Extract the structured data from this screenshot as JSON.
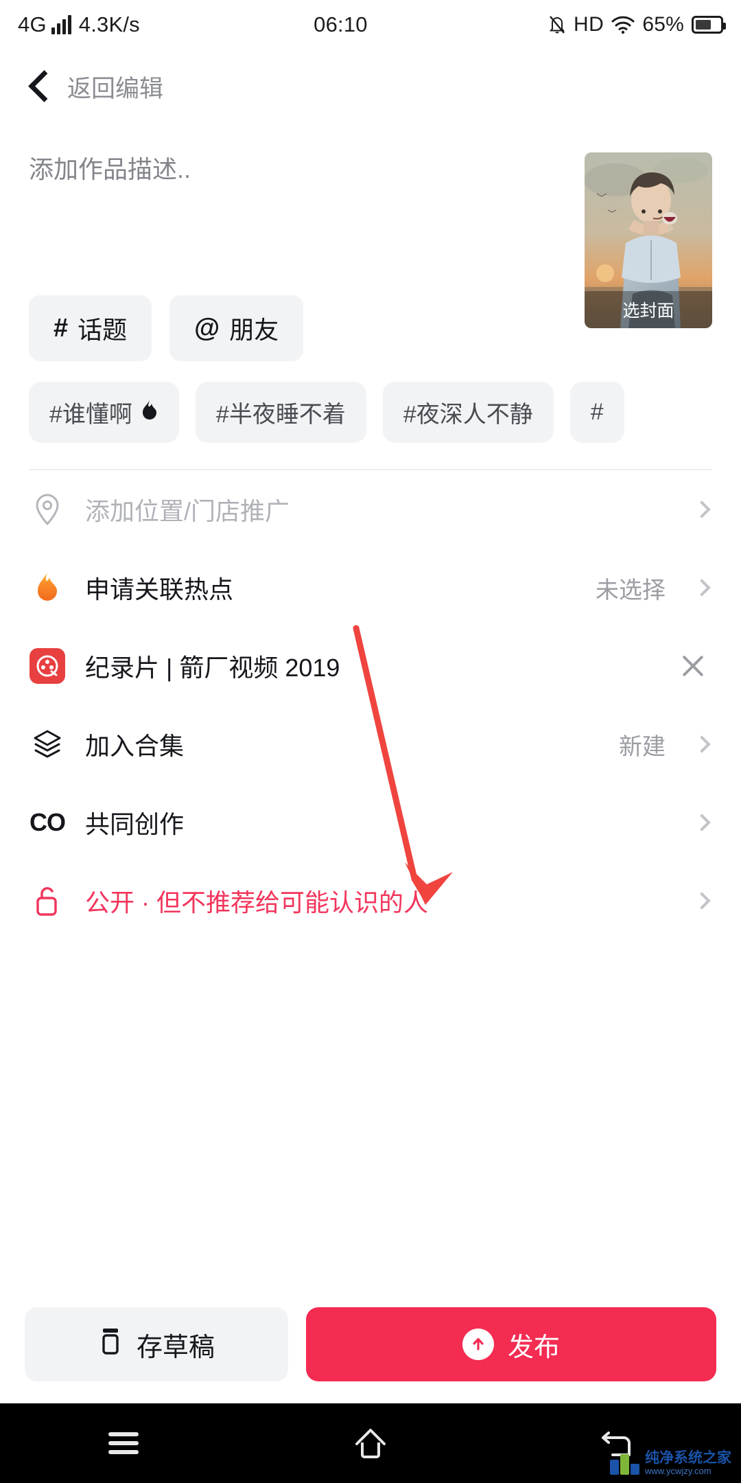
{
  "status_bar": {
    "network_type": "4G",
    "speed": "4.3K/s",
    "time": "06:10",
    "hd": "HD",
    "battery_percent": "65%",
    "signal_icon": "signal-bars-icon",
    "mute_icon": "bell-muted-icon",
    "wifi_icon": "wifi-icon",
    "battery_icon": "battery-icon"
  },
  "navbar": {
    "back_icon": "chevron-left-icon",
    "title": "返回编辑"
  },
  "composer": {
    "description_placeholder": "添加作品描述..",
    "description_value": "",
    "chips": [
      {
        "symbol": "#",
        "label": "话题",
        "icon": "hash-icon"
      },
      {
        "symbol": "@",
        "label": "朋友",
        "icon": "at-icon"
      }
    ],
    "cover": {
      "label": "选封面",
      "icon": "cover-thumbnail"
    }
  },
  "hashtag_suggestions": [
    {
      "label": "#谁懂啊",
      "trailing_icon": "flame-icon"
    },
    {
      "label": "#半夜睡不着",
      "trailing_icon": ""
    },
    {
      "label": "#夜深人不静",
      "trailing_icon": ""
    },
    {
      "label": "#",
      "trailing_icon": ""
    }
  ],
  "rows": [
    {
      "icon": "location-pin-icon",
      "label": "添加位置/门店推广",
      "value": "",
      "trailing": "chevron-right-icon",
      "style": "muted"
    },
    {
      "icon": "flame-icon",
      "label": "申请关联热点",
      "value": "未选择",
      "trailing": "chevron-right-icon",
      "style": "normal"
    },
    {
      "icon": "film-reel-icon",
      "label": "纪录片 | 箭厂视频 2019",
      "value": "",
      "trailing": "close-icon",
      "style": "normal"
    },
    {
      "icon": "layers-icon",
      "label": "加入合集",
      "value": "新建",
      "trailing": "chevron-right-icon",
      "style": "normal"
    },
    {
      "icon": "co-create-icon",
      "label": "共同创作",
      "value": "",
      "trailing": "chevron-right-icon",
      "style": "normal"
    },
    {
      "icon": "unlock-icon",
      "label": "公开 · 但不推荐给可能认识的人",
      "value": "",
      "trailing": "chevron-right-icon",
      "style": "danger"
    }
  ],
  "actions": {
    "draft_label": "存草稿",
    "draft_icon": "draft-box-icon",
    "publish_label": "发布",
    "publish_icon": "arrow-up-circle-icon"
  },
  "android_nav": {
    "recents_icon": "menu-icon",
    "home_icon": "home-icon",
    "back_icon": "back-arrow-icon"
  },
  "watermark": {
    "title": "纯净系统之家",
    "url": "www.ycwjzy.com"
  },
  "colors": {
    "accent_red": "#f42c52",
    "danger_text": "#f2355c",
    "chip_bg": "#f2f3f5",
    "muted_text": "#b0b2b8",
    "annotation_arrow": "#f0443f"
  }
}
